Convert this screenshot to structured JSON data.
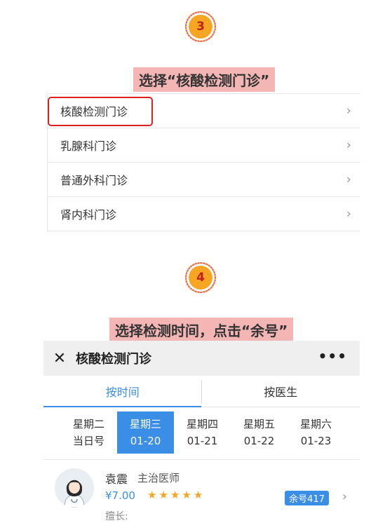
{
  "steps": [
    {
      "number": "3",
      "caption": "选择“核酸检测门诊”"
    },
    {
      "number": "4",
      "caption": "选择检测时间，点击“余号”"
    }
  ],
  "departments": [
    {
      "label": "核酸检测门诊"
    },
    {
      "label": "乳腺科门诊"
    },
    {
      "label": "普通外科门诊"
    },
    {
      "label": "肾内科门诊"
    }
  ],
  "app": {
    "title": "核酸检测门诊",
    "close_icon": "close-icon",
    "more_icon": "more-icon",
    "tabs": [
      {
        "label": "按时间",
        "active": true
      },
      {
        "label": "按医生",
        "active": false
      }
    ],
    "days": [
      {
        "weekday": "星期二",
        "date": "当日号",
        "selected": false
      },
      {
        "weekday": "星期三",
        "date": "01-20",
        "selected": true
      },
      {
        "weekday": "星期四",
        "date": "01-21",
        "selected": false
      },
      {
        "weekday": "星期五",
        "date": "01-22",
        "selected": false
      },
      {
        "weekday": "星期六",
        "date": "01-23",
        "selected": false
      }
    ],
    "doctor": {
      "name": "袁震",
      "title": "主治医师",
      "price": "¥7.00",
      "rating": 5,
      "remaining": "余号417",
      "specialty": "擅长:"
    }
  },
  "colors": {
    "accent": "#3a8ee6",
    "caption_bg": "#f4b6b4",
    "highlight": "#e0201e",
    "badge": "#f6a623"
  }
}
